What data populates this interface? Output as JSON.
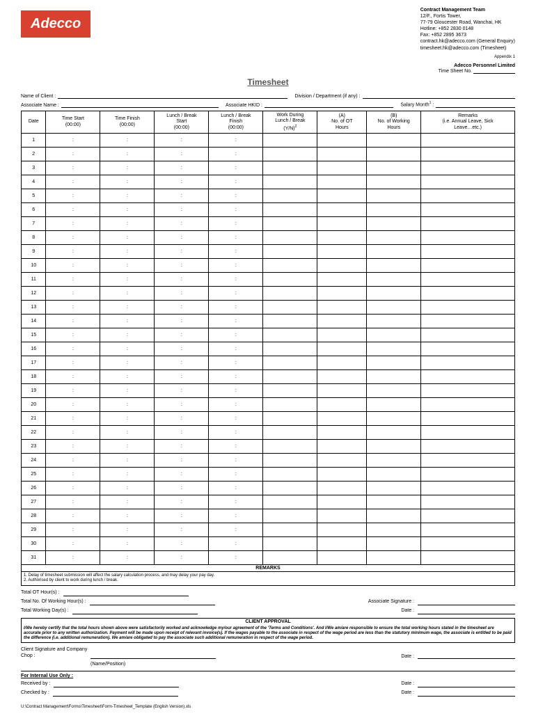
{
  "logo": "Adecco",
  "contact": {
    "title": "Contract Management Team",
    "addr1": "12/F., Fortis Tower,",
    "addr2": "77-79 Gloucester Road, Wanchai, HK",
    "hotline": "Hotline:    +852 2830 0148",
    "fax": "Fax:          +852 2895 3673",
    "email1": "contract.hk@adecco.com (General Enquiry)",
    "email2": "timesheet.hk@adecco.com (Timesheet)"
  },
  "appendix": "Appendix 1",
  "company": "Adecco Personnel Limited",
  "sheetno_label": "Time Sheet No.",
  "title": "Timesheet",
  "fields": {
    "client": "Name of Client :",
    "division": "Division / Department (if any) :",
    "assoc_name": "Associate Name :",
    "assoc_hkid": "Associate HKID :",
    "salary_month": "Salary Month"
  },
  "headers": {
    "date": "Date",
    "time_start": "Time Start\n(00:00)",
    "time_finish": "Time Finish\n(00:00)",
    "lunch_start": "Lunch / Break\nStart\n(00:00)",
    "lunch_finish": "Lunch / Break\nFinish\n(00:00)",
    "work_lunch": "Work During\nLunch / Break\n(Y/N)",
    "ot_hours": "(A)\nNo. of OT\nHours",
    "work_hours": "(B)\nNo. of Working\nHours",
    "remarks": "Remarks\n(i.e. Annual Leave, Sick\nLeave…etc.)"
  },
  "cell_placeholder": ":",
  "rows": [
    1,
    2,
    3,
    4,
    5,
    6,
    7,
    8,
    9,
    10,
    11,
    12,
    13,
    14,
    15,
    16,
    17,
    18,
    19,
    20,
    21,
    22,
    23,
    24,
    25,
    26,
    27,
    28,
    29,
    30,
    31
  ],
  "remarks_section": {
    "title": "REMARKS",
    "line1": "1. Delay of timesheet submission will affect the salary calculation process, and may delay your pay day.",
    "line2": "2. Authorised by client to work during lunch / break."
  },
  "totals": {
    "ot": "Total OT Hour(s) :",
    "work": "Total No. Of Working Hour(s) :",
    "days": "Total Working Day(s) :",
    "assoc_sig": "Associate Signature :",
    "date": "Date :"
  },
  "approval": {
    "title": "CLIENT APPROVAL",
    "text": "I/We hereby certify that the total hours shown above were satisfactorily worked and acknowledge my/our agreement of the 'Terms and Conditions'. And I/We am/are responsible to ensure the total working hours stated in the timesheet are accurate prior to any written authorization. Payment will be made upon receipt of relevant invoice(s). If the wages payable to the associate in respect of the wage period are less than the statutory minimum wage, the associate is entitled to be paid the difference (i.e. additional remuneration). We am/are obligated to pay the associate such additional remuneration in respect of the wage period."
  },
  "client_sig": {
    "label": "Client Signature and Company\nChop :",
    "name_pos": "(Name/Position)",
    "date": "Date :"
  },
  "internal": {
    "title": "For Internal Use Only :",
    "received": "Received by :",
    "checked": "Checked by :",
    "date": "Date :"
  },
  "footer": "U:\\Contract Management\\Forms\\Timesheet\\Form-Timesheet_Template (English Version).xls"
}
